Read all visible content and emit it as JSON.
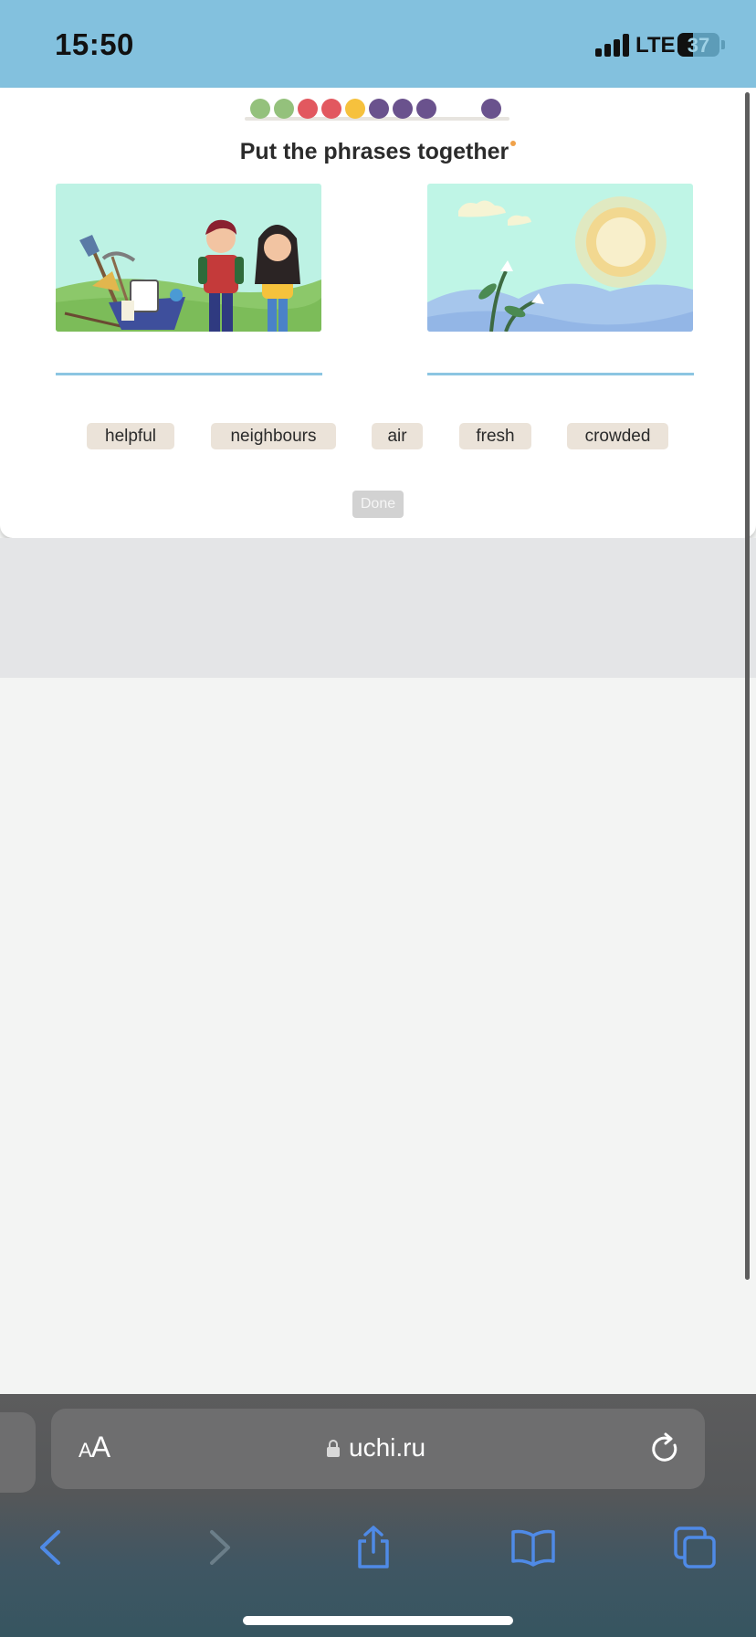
{
  "status_bar": {
    "time": "15:50",
    "network": "LTE",
    "battery_level": 37,
    "battery_label": "37"
  },
  "progress": {
    "dots": [
      {
        "status": "correct",
        "color": "#94c17c"
      },
      {
        "status": "correct",
        "color": "#94c17c"
      },
      {
        "status": "wrong",
        "color": "#e2585f"
      },
      {
        "status": "wrong",
        "color": "#e2585f"
      },
      {
        "status": "partial",
        "color": "#f6c13d"
      },
      {
        "status": "pending",
        "color": "#6a528d"
      },
      {
        "status": "pending",
        "color": "#6a528d"
      },
      {
        "status": "pending",
        "color": "#6a528d"
      },
      {
        "status": "current",
        "color": "#6a528d"
      }
    ]
  },
  "task": {
    "title": "Put the phrases together",
    "pictures": [
      {
        "name": "neighbours-picture",
        "depicts": "two people with garden tools and a wheelbarrow"
      },
      {
        "name": "nature-picture",
        "depicts": "sun over blue hills with white flowers"
      }
    ],
    "words": [
      "helpful",
      "neighbours",
      "air",
      "fresh",
      "crowded"
    ],
    "done_label": "Done"
  },
  "browser": {
    "text_size_label_small": "A",
    "text_size_label_large": "A",
    "url": "uchi.ru",
    "icons": [
      "lock-icon",
      "reload-icon",
      "back-icon",
      "forward-icon",
      "share-icon",
      "bookmarks-icon",
      "tabs-icon"
    ]
  },
  "colors": {
    "status_bar": "#83c1de",
    "answer_line": "#8cc5e2",
    "word_chip": "#ebe3d9",
    "done_disabled": "#d2d2d2",
    "browser_accent": "#4f8ae6"
  }
}
